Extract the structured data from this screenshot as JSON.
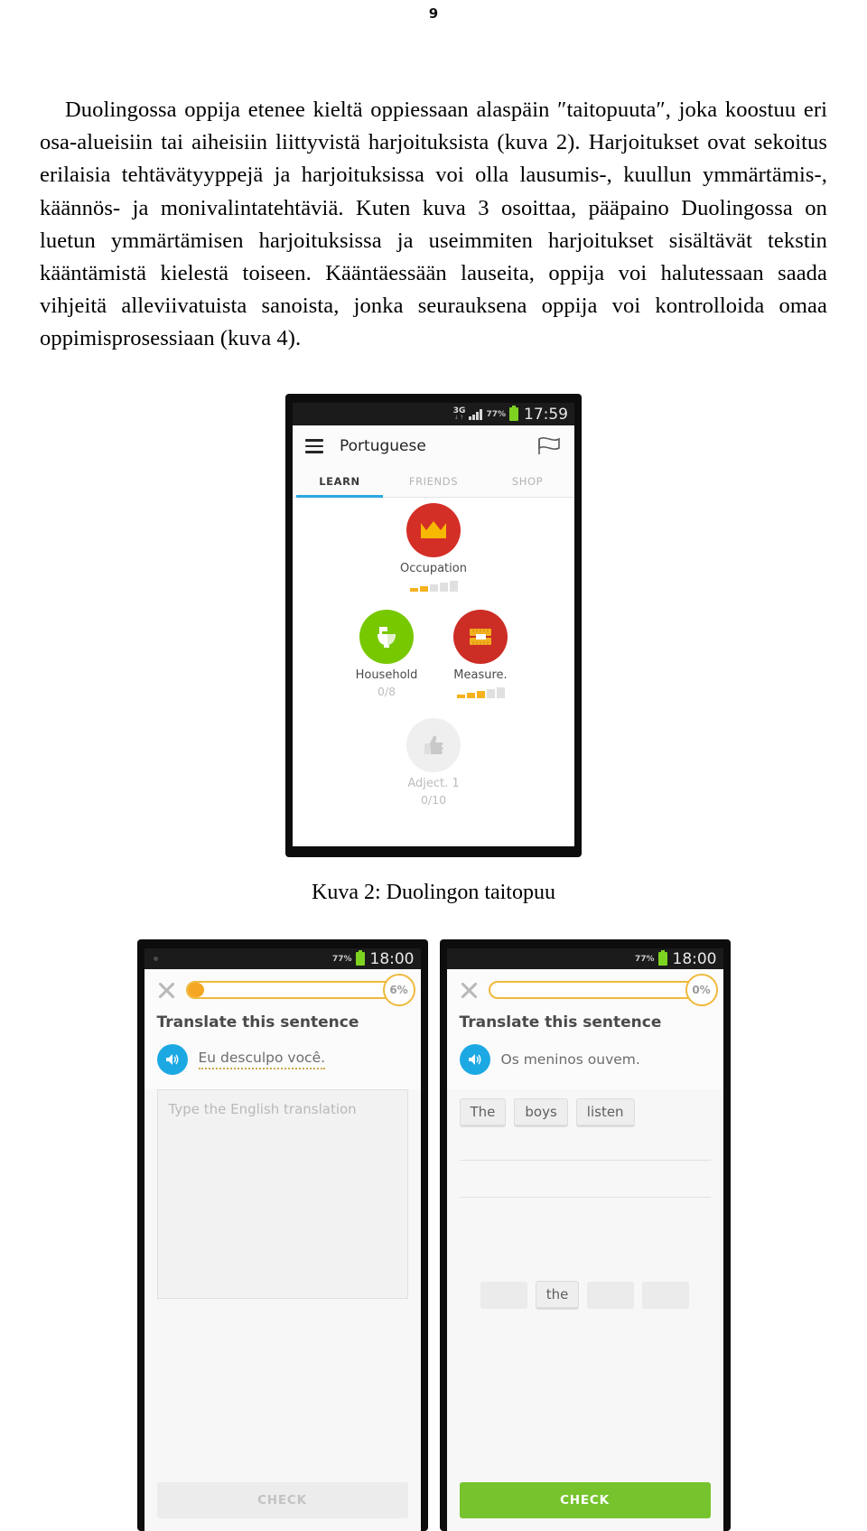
{
  "page": {
    "number": "9"
  },
  "body": {
    "paragraph": "Duolingossa oppija etenee kieltä oppiessaan alaspäin ″taitopuuta″, joka koostuu eri osa-alueisiin tai aiheisiin liittyvistä harjoituksista (kuva 2). Harjoitukset ovat sekoitus erilaisia tehtävätyyppejä ja harjoituksissa voi olla lausumis-, kuullun ymmärtämis-, käännös- ja monivalintatehtäviä. Kuten kuva 3 osoittaa, pääpaino Duolingossa on luetun ymmärtämisen harjoituksissa ja useimmiten harjoitukset sisältävät tekstin kääntämistä kielestä toiseen. Kääntäessään lauseita, oppija voi halutessaan saada vihjeitä alleviivatuista sanoista, jonka seurauksena oppija voi kontrolloida omaa oppimisprosessiaan (kuva 4)."
  },
  "figure1": {
    "caption": "Kuva 2: Duolingon taitopuu",
    "statusbar": {
      "network": "3G",
      "network_sub": "↓↑",
      "battery_percent": "77%",
      "time": "17:59"
    },
    "appbar": {
      "menu_icon": "hamburger-icon",
      "title": "Portuguese",
      "right_icon": "flag-icon"
    },
    "tabs": [
      {
        "label": "LEARN",
        "active": true
      },
      {
        "label": "FRIENDS",
        "active": false
      },
      {
        "label": "SHOP",
        "active": false
      }
    ],
    "accent_color": "#2ba7e0",
    "skills": [
      {
        "name": "Occupation",
        "icon": "crown-icon",
        "circle_color": "#d42f27",
        "icon_color": "#f6b800",
        "segments_filled": 2,
        "segments_total": 5,
        "count": null,
        "locked": false
      },
      {
        "name": "Household",
        "icon": "toilet-icon",
        "circle_color": "#78c800",
        "icon_color": "#ffffff",
        "segments_filled": 0,
        "segments_total": 0,
        "count": "0/8",
        "locked": false
      },
      {
        "name": "Measure.",
        "icon": "ruler-icon",
        "circle_color": "#cc2d25",
        "icon_color": "#f2b01e",
        "segments_filled": 3,
        "segments_total": 5,
        "count": null,
        "locked": false
      },
      {
        "name": "Adject. 1",
        "icon": "thumbs-up-icon",
        "circle_color": "#efefef",
        "icon_color": "#c9c9c9",
        "segments_filled": 0,
        "segments_total": 0,
        "count": "0/10",
        "locked": true
      }
    ]
  },
  "figure2": {
    "phones": [
      {
        "statusbar": {
          "battery_percent": "77%",
          "time": "18:00"
        },
        "close_icon": "close-x-icon",
        "progress_percent_label": "6%",
        "progress_fill_ratio": 0.06,
        "prompt": "Translate this sentence",
        "speaker_icon": "speaker-icon",
        "sentence": "Eu desculpo você.",
        "sentence_hinted": true,
        "answer_placeholder": "Type the English translation",
        "answer_value": "",
        "check_label": "CHECK",
        "check_enabled": false,
        "word_bank": []
      },
      {
        "statusbar": {
          "battery_percent": "77%",
          "time": "18:00"
        },
        "close_icon": "close-x-icon",
        "progress_percent_label": "0%",
        "progress_fill_ratio": 0.0,
        "prompt": "Translate this sentence",
        "speaker_icon": "speaker-icon",
        "sentence": "Os meninos ouvem.",
        "sentence_hinted": false,
        "answer_placeholder": "",
        "answer_value": "",
        "check_label": "CHECK",
        "check_enabled": true,
        "word_bank": [
          "The",
          "boys",
          "listen"
        ],
        "selected_word": "the"
      }
    ]
  }
}
